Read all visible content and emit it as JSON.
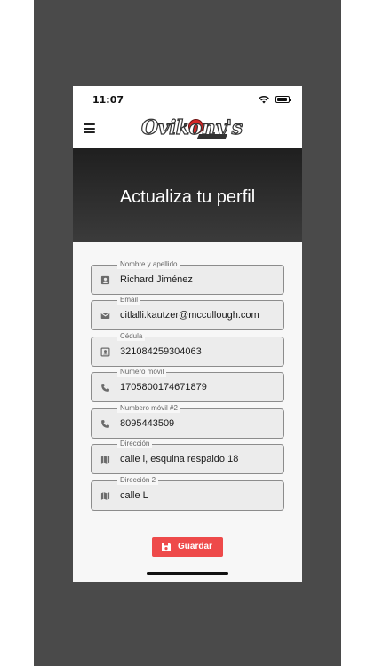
{
  "status_bar": {
    "time": "11:07",
    "icons": [
      "wifi-icon",
      "battery-icon"
    ]
  },
  "app_bar": {
    "menu_icon": "hamburger-menu-icon",
    "logo_text": "Ovikony's"
  },
  "hero": {
    "title": "Actualiza tu perfil"
  },
  "form": {
    "fields": [
      {
        "label": "Nombre y apellido",
        "value": "Richard Jiménez",
        "icon": "contact-card-icon"
      },
      {
        "label": "Email",
        "value": "citlalli.kautzer@mccullough.com",
        "icon": "mail-icon"
      },
      {
        "label": "Cédula",
        "value": "321084259304063",
        "icon": "id-card-icon"
      },
      {
        "label": "Número móvil",
        "value": "1705800174671879",
        "icon": "phone-icon"
      },
      {
        "label": "Numbero móvil #2",
        "value": "8095443509",
        "icon": "phone-icon"
      },
      {
        "label": "Dirección",
        "value": "calle l, esquina respaldo 18",
        "icon": "map-icon"
      },
      {
        "label": "Dirección 2",
        "value": "calle L",
        "icon": "map-icon"
      }
    ]
  },
  "save_button": {
    "label": "Guardar",
    "icon": "floppy-disk-icon"
  },
  "colors": {
    "accent": "#ee4a4a",
    "hero_dark": "#1f1f1f",
    "backdrop": "#4a4a4a"
  }
}
